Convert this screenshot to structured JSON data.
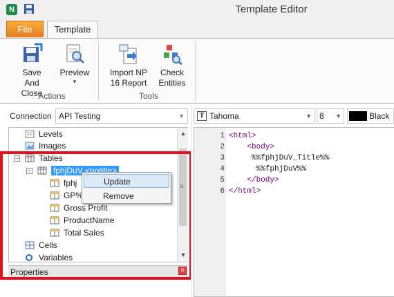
{
  "window": {
    "title": "Template Editor"
  },
  "ribbon": {
    "tabs": {
      "file": "File",
      "template": "Template"
    },
    "buttons": {
      "save_and_close": "Save And Close",
      "preview": "Preview",
      "import_np": "Import NP 16 Report",
      "check_entities": "Check Entities"
    },
    "groups": {
      "actions": "Actions",
      "tools": "Tools"
    }
  },
  "connection": {
    "label": "Connection",
    "value": "API Testing"
  },
  "tree": {
    "levels": "Levels",
    "images": "Images",
    "tables": "Tables",
    "table_node": "fphjDuV",
    "table_node_suffix": "<notitle>",
    "fields": [
      "fphj",
      "GP%",
      "Gross Profit",
      "ProductName",
      "Total Sales"
    ],
    "cells": "Cells",
    "variables": "Variables"
  },
  "context_menu": {
    "update": "Update",
    "remove": "Remove"
  },
  "properties": {
    "label": "Properties"
  },
  "editor": {
    "font": "Tahoma",
    "size": "8",
    "color": "Black",
    "lines": [
      {
        "n": "1",
        "text": "<html>"
      },
      {
        "n": "2",
        "text": "    <body>"
      },
      {
        "n": "3",
        "text": "     %%fphjDuV_Title%%"
      },
      {
        "n": "4",
        "text": "      %%fphjDuV%%"
      },
      {
        "n": "5",
        "text": "    </body>"
      },
      {
        "n": "6",
        "text": "</html>"
      }
    ]
  },
  "colors": {
    "file_tab": "#e67e22",
    "selection": "#3399ff",
    "annotation": "#e3121a",
    "tag": "#800080"
  }
}
